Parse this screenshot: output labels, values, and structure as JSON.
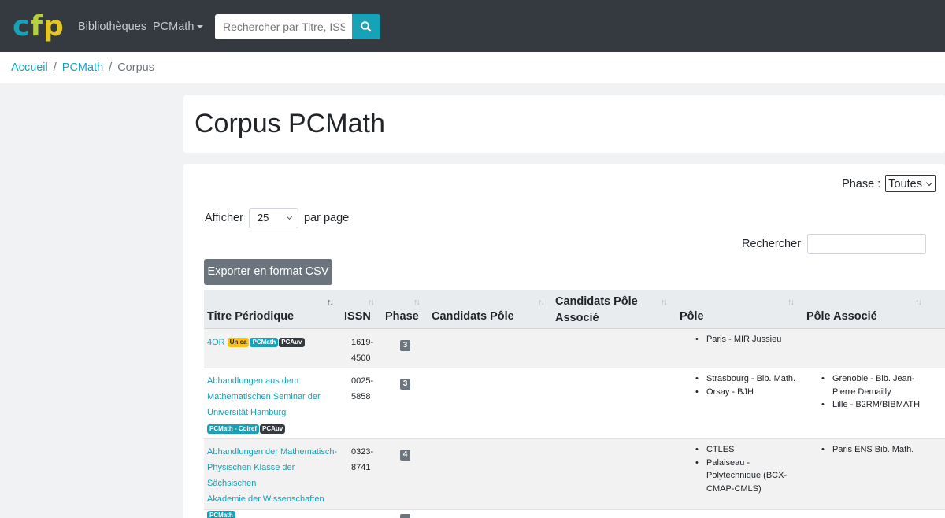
{
  "nav": {
    "logo": {
      "c": "c",
      "f": "f",
      "p": "p"
    },
    "links": [
      "Bibliothèques",
      "PCMath"
    ],
    "search_placeholder": "Rechercher par Titre, ISSN"
  },
  "breadcrumb": {
    "home": "Accueil",
    "section": "PCMath",
    "current": "Corpus"
  },
  "page_title": "Corpus PCMath",
  "filters": {
    "phase_label": "Phase :",
    "phase_value": "Toutes",
    "show_label": "Afficher",
    "per_page_value": "25",
    "per_page_suffix": "par page",
    "search_label": "Rechercher",
    "export_label": "Exporter en format CSV"
  },
  "table": {
    "headers": [
      "Titre Périodique",
      "ISSN",
      "Phase",
      "Candidats Pôle",
      "Candidats Pôle Associé",
      "Pôle",
      "Pôle Associé"
    ],
    "rows": [
      {
        "title": "4OR",
        "badges": [
          "Unica",
          "PCMath",
          "PCAuv"
        ],
        "issn": [
          "1619-",
          "4500"
        ],
        "phase": "3",
        "pole": [
          "Paris - MIR Jussieu"
        ],
        "pole_associe": []
      },
      {
        "title_lines": [
          "Abhandlungen aus dem",
          "Mathematischen Seminar der",
          "Universität Hamburg"
        ],
        "badges": [
          "PCMath - Colref",
          "PCAuv"
        ],
        "issn": [
          "0025-",
          "5858"
        ],
        "phase": "3",
        "pole": [
          "Strasbourg - Bib. Math.",
          "Orsay - BJH"
        ],
        "pole_associe": [
          "Grenoble - Bib. Jean-Pierre Demailly",
          "Lille - B2RM/BIBMATH"
        ]
      },
      {
        "title_lines": [
          "Abhandlungen der Mathematisch-",
          "Physischen Klasse der Sächsischen",
          "Akademie der Wissenschaften"
        ],
        "badges": [
          "PCMath"
        ],
        "issn": [
          "0323-",
          "8741"
        ],
        "phase": "4",
        "pole": [
          "CTLES",
          "Palaiseau - Polytechnique (BCX-CMAP-CMLS)"
        ],
        "pole_associe": [
          "Paris ENS Bib. Math."
        ]
      }
    ]
  },
  "colors": {
    "navbar": "#343a40",
    "accent": "#17a2b8",
    "unica": "#ffc107",
    "dark_badge": "#343a40",
    "secondary": "#6c757d"
  },
  "icons": {
    "search": "magnifier-icon"
  }
}
